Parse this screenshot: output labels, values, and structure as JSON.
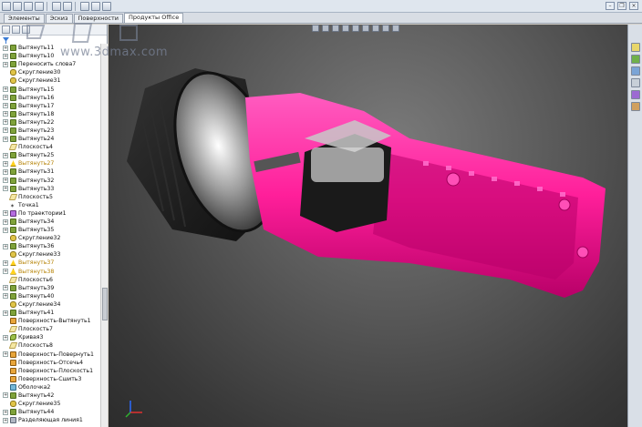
{
  "toolbar": {
    "icons": [
      "new-icon",
      "open-icon",
      "save-icon",
      "print-icon",
      "undo-icon",
      "select-icon",
      "rebuild-icon",
      "options-icon",
      "help-icon"
    ]
  },
  "tabs": [
    {
      "label": "Элементы"
    },
    {
      "label": "Эскиз"
    },
    {
      "label": "Поверхности"
    },
    {
      "label": "Продукты Office"
    }
  ],
  "watermark": {
    "text": "www.3dmax.com"
  },
  "tree": {
    "items": [
      {
        "label": "Вытянуть11",
        "icon": "ext",
        "expandable": true
      },
      {
        "label": "Вытянуть10",
        "icon": "ext",
        "expandable": true
      },
      {
        "label": "Переносить слова7",
        "icon": "ext",
        "expandable": true
      },
      {
        "label": "Скругление30",
        "icon": "fillet",
        "expandable": false
      },
      {
        "label": "Скругление31",
        "icon": "fillet",
        "expandable": false
      },
      {
        "label": "Вытянуть15",
        "icon": "ext",
        "expandable": true
      },
      {
        "label": "Вытянуть16",
        "icon": "ext",
        "expandable": true
      },
      {
        "label": "Вытянуть17",
        "icon": "ext",
        "expandable": true
      },
      {
        "label": "Вытянуть18",
        "icon": "ext",
        "expandable": true
      },
      {
        "label": "Вытянуть22",
        "icon": "ext",
        "expandable": true
      },
      {
        "label": "Вытянуть23",
        "icon": "ext",
        "expandable": true
      },
      {
        "label": "Вытянуть24",
        "icon": "ext",
        "expandable": true
      },
      {
        "label": "Плоскость4",
        "icon": "plane",
        "expandable": false
      },
      {
        "label": "Вытянуть25",
        "icon": "ext",
        "expandable": true
      },
      {
        "label": "Вытянуть27",
        "icon": "warn",
        "expandable": true,
        "warn": true
      },
      {
        "label": "Вытянуть31",
        "icon": "ext",
        "expandable": true
      },
      {
        "label": "Вытянуть32",
        "icon": "ext",
        "expandable": true
      },
      {
        "label": "Вытянуть33",
        "icon": "ext",
        "expandable": true
      },
      {
        "label": "Плоскость5",
        "icon": "plane",
        "expandable": false
      },
      {
        "label": "Точка1",
        "icon": "point",
        "expandable": false
      },
      {
        "label": "По траектории1",
        "icon": "sweep",
        "expandable": true
      },
      {
        "label": "Вытянуть34",
        "icon": "ext",
        "expandable": true
      },
      {
        "label": "Вытянуть35",
        "icon": "ext",
        "expandable": true
      },
      {
        "label": "Скругление32",
        "icon": "fillet",
        "expandable": false
      },
      {
        "label": "Вытянуть36",
        "icon": "ext",
        "expandable": true
      },
      {
        "label": "Скругление33",
        "icon": "fillet",
        "expandable": false
      },
      {
        "label": "Вытянуть37",
        "icon": "warn",
        "expandable": true,
        "warn": true
      },
      {
        "label": "Вытянуть38",
        "icon": "warn",
        "expandable": true,
        "warn": true
      },
      {
        "label": "Плоскость6",
        "icon": "plane",
        "expandable": false
      },
      {
        "label": "Вытянуть39",
        "icon": "ext",
        "expandable": true
      },
      {
        "label": "Вытянуть40",
        "icon": "ext",
        "expandable": true
      },
      {
        "label": "Скругление34",
        "icon": "fillet",
        "expandable": false
      },
      {
        "label": "Вытянуть41",
        "icon": "ext",
        "expandable": true
      },
      {
        "label": "Поверхность-Вытянуть1",
        "icon": "surf",
        "expandable": false
      },
      {
        "label": "Плоскость7",
        "icon": "plane",
        "expandable": false
      },
      {
        "label": "Кривая3",
        "icon": "curve",
        "expandable": true
      },
      {
        "label": "Плоскость8",
        "icon": "plane",
        "expandable": false
      },
      {
        "label": "Поверхность-Повернуть1",
        "icon": "surf",
        "expandable": true
      },
      {
        "label": "Поверхность-Отсечь4",
        "icon": "surf",
        "expandable": false
      },
      {
        "label": "Поверхность-Плоскость1",
        "icon": "surf",
        "expandable": false
      },
      {
        "label": "Поверхность-Сшить3",
        "icon": "surf",
        "expandable": false
      },
      {
        "label": "Оболочка2",
        "icon": "shell",
        "expandable": false
      },
      {
        "label": "Вытянуть42",
        "icon": "ext",
        "expandable": true
      },
      {
        "label": "Скругление35",
        "icon": "fillet",
        "expandable": false
      },
      {
        "label": "Вытянуть44",
        "icon": "ext",
        "expandable": true
      },
      {
        "label": "Разделяющая линия1",
        "icon": "split",
        "expandable": true
      }
    ]
  },
  "colors": {
    "accent_pink": "#ff1f9a",
    "body_dark": "#1c1c1c",
    "background": "#4a4a4a"
  },
  "taskpane": {
    "icons": [
      "resources-icon",
      "design-library-icon",
      "file-explorer-icon",
      "view-palette-icon",
      "appearances-icon",
      "custom-properties-icon"
    ]
  },
  "view_toolbar": {
    "icons": [
      "zoom-fit-icon",
      "zoom-area-icon",
      "prev-view-icon",
      "section-view-icon",
      "view-orientation-icon",
      "display-style-icon",
      "hide-show-icon",
      "appearance-icon",
      "scene-icon"
    ]
  }
}
